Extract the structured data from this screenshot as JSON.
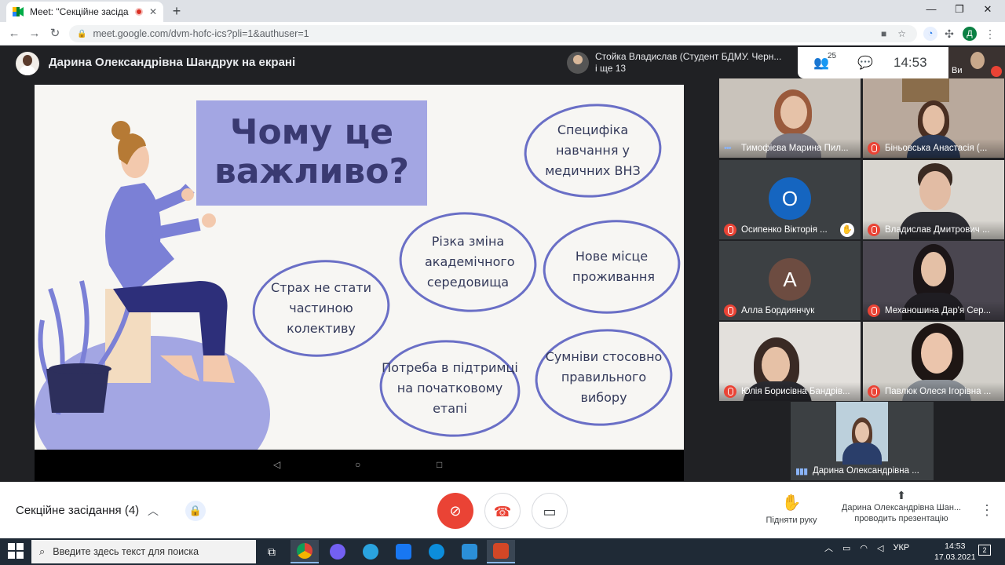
{
  "browser": {
    "tab_title": "Meet: \"Секційне засідання (",
    "close": "✕",
    "new_tab": "+",
    "url": "meet.google.com/dvm-hofc-ics?pli=1&authuser=1",
    "win_min": "—",
    "win_max": "❐",
    "win_close": "✕",
    "profile_letter": "Д"
  },
  "meet": {
    "presenter_banner": "Дарина Олександрівна Шандрук на екрані",
    "speaker_line1": "Стойка Владислав (Студент БДМУ. Черн...",
    "speaker_line2": "і ще 13",
    "people_count": "25",
    "time": "14:53",
    "self_label": "Ви"
  },
  "slide": {
    "title": "Чому це важливо?",
    "bubbles": [
      "Специфіка навчання у медичних ВНЗ",
      "Різка зміна академічного середовища",
      "Нове місце проживання",
      "Страх не стати частиною колективу",
      "Потреба в  підтримці на початковому етапі",
      "Сумніви стосовно правильного вибору"
    ],
    "nav": [
      "◁",
      "○",
      "□"
    ]
  },
  "participants": [
    {
      "name": "Тимофієва Марина Пил...",
      "mic": "speaking"
    },
    {
      "name": "Біньовська Анастасія (...",
      "mic": "muted"
    },
    {
      "name": "Осипенко Вікторія ...",
      "mic": "muted",
      "initial": "О",
      "color": "#1565c0",
      "hand": true
    },
    {
      "name": "Владислав Дмитрович ...",
      "mic": "muted"
    },
    {
      "name": "Алла Бордиянчук",
      "mic": "muted",
      "initial": "А",
      "color": "#6d4c41"
    },
    {
      "name": "Механошина Дар'я Сер...",
      "mic": "muted"
    },
    {
      "name": "Юлія Борисівна Бандрів...",
      "mic": "muted"
    },
    {
      "name": "Павлюк Олеся Ігорівна ...",
      "mic": "muted"
    },
    {
      "name": "Дарина Олександрівна ...",
      "mic": "speaking"
    }
  ],
  "bottom": {
    "meeting_name": "Секційне засідання (4)",
    "raise_hand": "Підняти руку",
    "presenting_line1": "Дарина Олександрівна Шан...",
    "presenting_line2": "проводить презентацію"
  },
  "taskbar": {
    "search_placeholder": "Введите здесь текст для поиска",
    "lang": "УКР",
    "time": "14:53",
    "date": "17.03.2021",
    "notif_count": "2"
  },
  "colors": {
    "accent_slide": "#a3a6e3",
    "bubble_stroke": "#6a6fc6",
    "end_call": "#ea4335"
  }
}
